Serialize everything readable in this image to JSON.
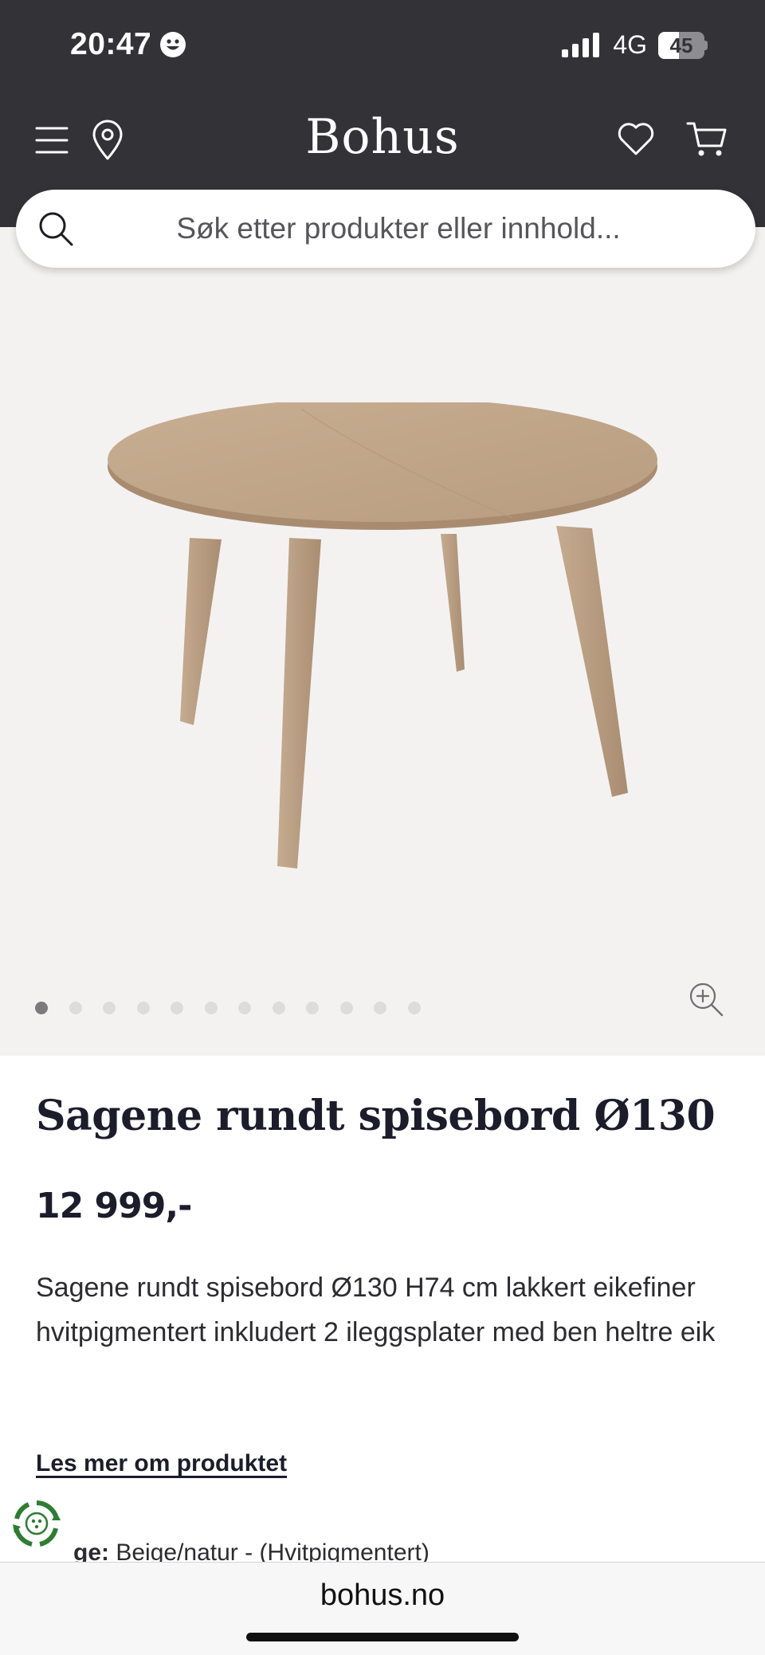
{
  "status_bar": {
    "time": "20:47",
    "network": "4G",
    "battery": "45",
    "battery_level": 0.45
  },
  "header": {
    "logo": "Bohus",
    "icons": [
      "menu-icon",
      "location-pin-icon",
      "heart-icon",
      "cart-icon"
    ]
  },
  "search": {
    "placeholder": "Søk etter produkter eller innhold..."
  },
  "gallery": {
    "image_count": 12,
    "active_index": 0,
    "image_subject": "round oak dining table"
  },
  "product": {
    "title": "Sagene rundt spisebord Ø130",
    "price": "12 999,-",
    "description": "Sagene rundt spisebord Ø130 H74 cm lakkert eikefiner hvitpigmentert inkludert 2 ileggsplater med ben heltre eik",
    "read_more": "Les mer om produktet",
    "color_label": "ge:",
    "color_value": "Beige/natur - (Hvitpigmentert)"
  },
  "browser": {
    "url": "bohus.no"
  },
  "colors": {
    "header_bg": "#333237",
    "gallery_bg": "#f4f2f1",
    "text_dark": "#1c1c2b",
    "eco_green": "#2e7d32"
  }
}
